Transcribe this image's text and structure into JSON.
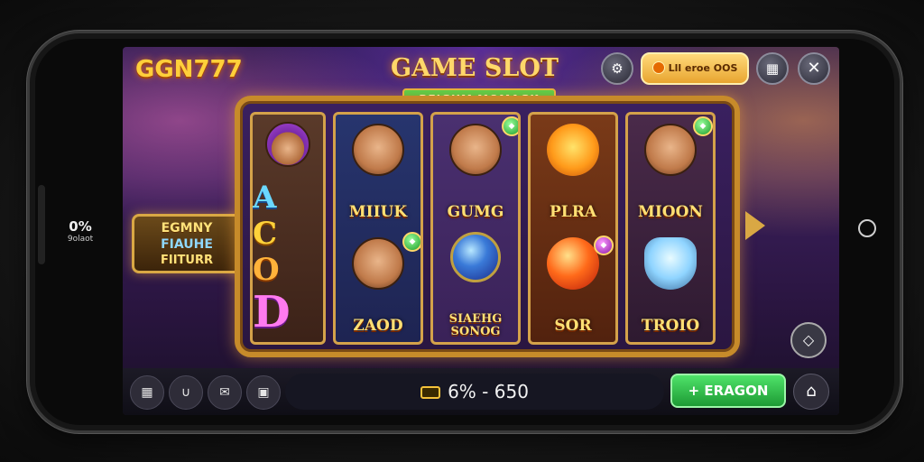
{
  "header": {
    "logo": "GGN777",
    "title": "GAME SLOT",
    "subtitle": "BEIGHM MOMAGK",
    "coin_label": "Lll eroe OOS",
    "icons": [
      "badge-icon",
      "coin-icon",
      "card-icon",
      "close-icon"
    ]
  },
  "side": {
    "percent": "0%",
    "sub": "9olaot"
  },
  "feature": {
    "line1": "EGMNY",
    "line2": "FIAUHE",
    "line3": "FIITURR"
  },
  "reels": [
    {
      "letters": [
        "A",
        "C",
        "O",
        "D"
      ]
    },
    {
      "top": "MIIUK",
      "bottom": "ZAOD"
    },
    {
      "top": "GUMG",
      "bottom_line1": "SIAEHG",
      "bottom_line2": "SONOG"
    },
    {
      "top": "PLRA",
      "bottom": "SOR"
    },
    {
      "top": "MIOON",
      "bottom": "TROIO"
    }
  ],
  "bottom": {
    "balance": "6% - 650",
    "spin_label": "+ ERAGON",
    "icons": [
      "grid-icon",
      "hook-icon",
      "chat-icon",
      "bag-icon",
      "home-icon"
    ]
  },
  "colors": {
    "accent_gold": "#ffd86a",
    "spin_green": "#1d9a34",
    "frame_gold": "#c78b2a"
  }
}
